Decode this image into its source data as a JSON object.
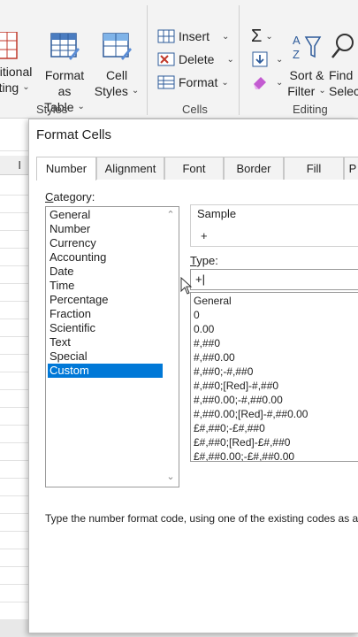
{
  "ribbon": {
    "conditional_formatting": {
      "line1": "ditional",
      "line2": "tting"
    },
    "format_as_table": {
      "line1": "Format as",
      "line2": "Table"
    },
    "cell_styles": {
      "line1": "Cell",
      "line2": "Styles"
    },
    "insert_label": "Insert",
    "delete_label": "Delete",
    "format_label": "Format",
    "sort_filter": {
      "line1": "Sort &",
      "line2": "Filter"
    },
    "find_select": {
      "line1": "Find",
      "line2": "Selec"
    },
    "groups": {
      "styles": "Styles",
      "cells": "Cells",
      "editing": "Editing"
    }
  },
  "sheet": {
    "column_header": "I"
  },
  "dialog": {
    "title": "Format Cells",
    "tabs": [
      "Number",
      "Alignment",
      "Font",
      "Border",
      "Fill",
      "P"
    ],
    "category_label_prefix": "C",
    "category_label_rest": "ategory:",
    "categories": [
      "General",
      "Number",
      "Currency",
      "Accounting",
      "Date",
      "Time",
      "Percentage",
      "Fraction",
      "Scientific",
      "Text",
      "Special",
      "Custom"
    ],
    "selected_category": "Custom",
    "sample_label": "Sample",
    "sample_value": "+",
    "type_label_prefix": "T",
    "type_label_rest": "ype:",
    "type_value": "+|",
    "format_codes": [
      "General",
      "0",
      "0.00",
      "#,##0",
      "#,##0.00",
      "#,##0;-#,##0",
      "#,##0;[Red]-#,##0",
      "#,##0.00;-#,##0.00",
      "#,##0.00;[Red]-#,##0.00",
      "£#,##0;-£#,##0",
      "£#,##0;[Red]-£#,##0",
      "£#,##0.00;-£#,##0.00"
    ],
    "hint": "Type the number format code, using one of the existing codes as a s"
  },
  "colors": {
    "selection": "#0078d7",
    "ribbon_bg": "#f3f3f3"
  }
}
